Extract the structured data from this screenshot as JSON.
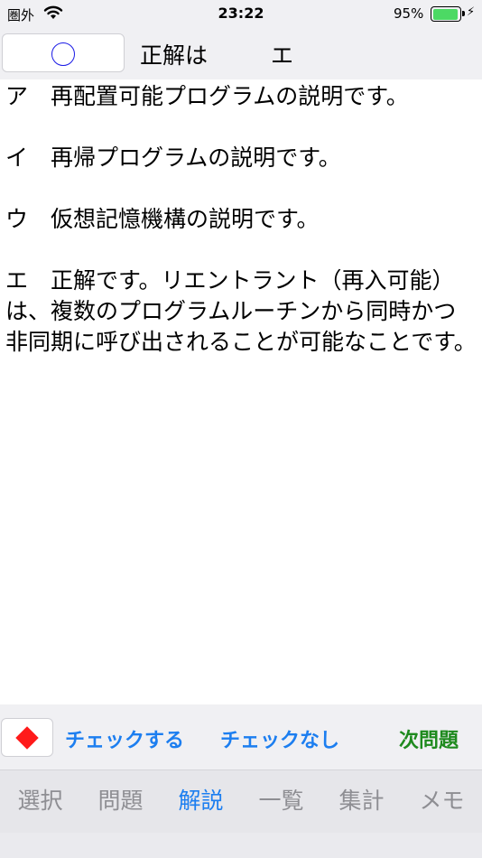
{
  "status_bar": {
    "carrier": "圏外",
    "time": "23:22",
    "battery_percent": "95%",
    "battery_level": 0.95
  },
  "answer": {
    "label": "正解は",
    "value": "エ",
    "mark_icon": "circle-icon"
  },
  "explanation": {
    "options": [
      {
        "text": "ア　再配置可能プログラムの説明です。"
      },
      {
        "text": "イ　再帰プログラムの説明です。"
      },
      {
        "text": "ウ　仮想記憶機構の説明です。"
      },
      {
        "text": "エ　正解です。リエントラント（再入可能）は、複数のプログラムルーチンから同時かつ非同期に呼び出されることが可能なことです。"
      }
    ]
  },
  "check_toolbar": {
    "mark_icon": "red-diamond-icon",
    "check_label": "チェックする",
    "uncheck_label": "チェックなし",
    "next_label": "次問題",
    "colors": {
      "action": "#1c7ef0",
      "next": "#1e8a1e",
      "mark": "#ff1a1a"
    }
  },
  "tabs": [
    {
      "label": "選択",
      "active": false
    },
    {
      "label": "問題",
      "active": false
    },
    {
      "label": "解説",
      "active": true
    },
    {
      "label": "一覧",
      "active": false
    },
    {
      "label": "集計",
      "active": false
    },
    {
      "label": "メモ",
      "active": false
    }
  ]
}
